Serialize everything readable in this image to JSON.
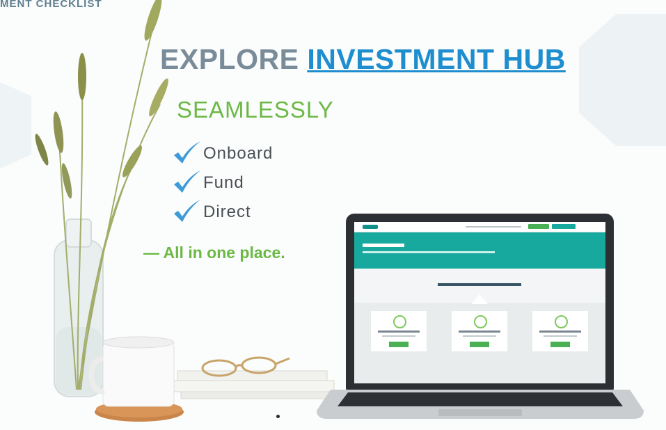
{
  "breadcrumb": "MENT CHECKLIST",
  "headline": {
    "prefix": "EXPLORE",
    "link": "INVESTMENT HUB"
  },
  "subhead": "SEAMLESSLY",
  "checklist": [
    {
      "label": "Onboard",
      "icon": "check-icon"
    },
    {
      "label": "Fund",
      "icon": "check-icon"
    },
    {
      "label": "Direct",
      "icon": "check-icon"
    }
  ],
  "tagline": "— All in one place.",
  "colors": {
    "headline_gray": "#7a8c99",
    "link_blue": "#1f8ecf",
    "accent_green": "#6bb944",
    "check_blue": "#3f9ad8",
    "screen_teal": "#17a99d"
  }
}
